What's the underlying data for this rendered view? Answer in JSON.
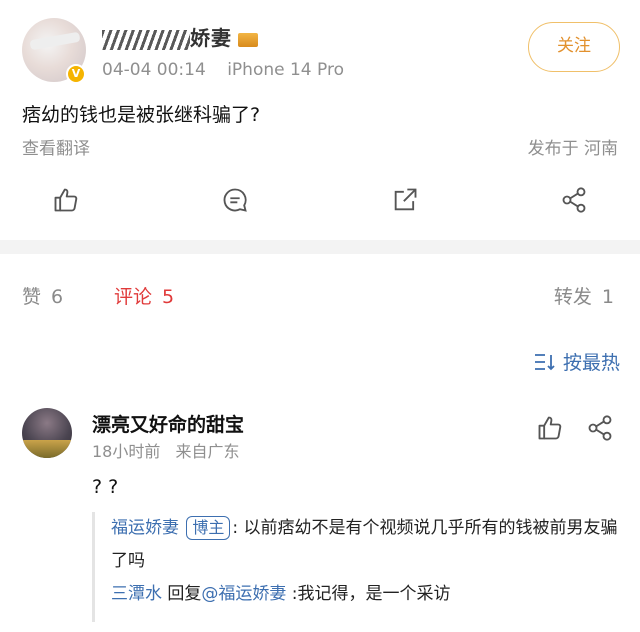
{
  "post": {
    "author_name_prefix": "福运娇妻",
    "author_name_visible": "娇妻",
    "time": "04-04 00:14",
    "device": "iPhone 14 Pro",
    "follow_label": "关注",
    "text": "痞幼的钱也是被张继科骗了?",
    "translate_label": "查看翻译",
    "location": "发布于 河南"
  },
  "icons": {
    "like": "thumbs-up-icon",
    "comment": "comment-icon",
    "repost": "repost-icon",
    "share": "share-icon",
    "sort": "sort-icon",
    "vip": "verified-badge-icon"
  },
  "tabs": {
    "like_label": "赞",
    "like_count": "6",
    "comment_label": "评论",
    "comment_count": "5",
    "repost_label": "转发",
    "repost_count": "1"
  },
  "sort_label": "按最热",
  "comment": {
    "name": "漂亮又好命的甜宝",
    "time": "18小时前",
    "from": "来自广东",
    "text": "? ?"
  },
  "replies": {
    "r1_user": "福运娇妻",
    "r1_tag": "博主",
    "r1_text": ": 以前痞幼不是有个视频说几乎所有的钱被前男友骗了吗",
    "r2_user": "三潭水",
    "r2_mid": " 回复",
    "r2_mention": "@福运娇妻",
    "r2_text": " :我记得，是一个采访"
  },
  "colors": {
    "accent_red": "#e03a3a",
    "link_blue": "#3d6fb0",
    "follow_orange": "#e2912e",
    "muted_gray": "#8f8f8f"
  }
}
